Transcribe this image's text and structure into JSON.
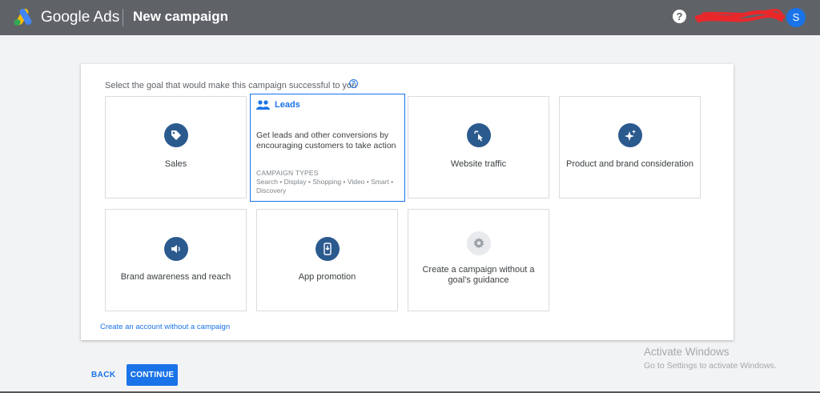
{
  "header": {
    "brand": "Google Ads",
    "page_title": "New campaign",
    "help_label": "?",
    "avatar_initial": "S"
  },
  "main": {
    "prompt": "Select the goal that would make this campaign successful to you",
    "goals": [
      {
        "label": "Sales",
        "icon": "tag-icon",
        "selected": false
      },
      {
        "label": "Leads",
        "icon": "people-icon",
        "selected": true,
        "description": "Get leads and other conversions by encouraging customers to take action",
        "campaign_types_heading": "CAMPAIGN TYPES",
        "campaign_types": "Search • Display • Shopping • Video • Smart • Discovery"
      },
      {
        "label": "Website traffic",
        "icon": "cursor-click-icon",
        "selected": false
      },
      {
        "label": "Product and brand consideration",
        "icon": "sparkle-icon",
        "selected": false
      },
      {
        "label": "Brand awareness and reach",
        "icon": "speaker-icon",
        "selected": false
      },
      {
        "label": "App promotion",
        "icon": "phone-download-icon",
        "selected": false
      },
      {
        "label": "Create a campaign without a goal's guidance",
        "icon": "gear-icon",
        "selected": false
      }
    ],
    "create_account_link": "Create an account without a campaign"
  },
  "footer": {
    "back_label": "BACK",
    "continue_label": "CONTINUE"
  },
  "watermark": {
    "line1": "Activate Windows",
    "line2": "Go to Settings to activate Windows."
  },
  "colors": {
    "topbar": "#5f6368",
    "accent": "#1a73e8",
    "icon_circle": "#2b5a8e"
  }
}
